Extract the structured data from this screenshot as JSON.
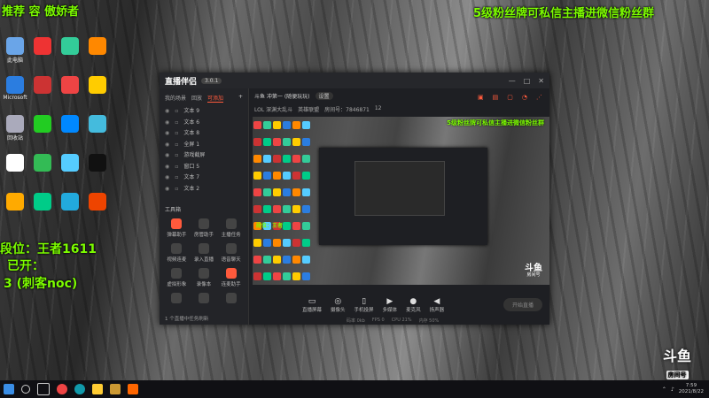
{
  "overlay": {
    "top_left": "推荐 容 傲娇者",
    "top_right": "5级粉丝牌可私信主播进微信粉丝群",
    "left_lines": [
      "段位：王者1611",
      "已开：",
      "3 (刺客noc)"
    ]
  },
  "desktop_icons": [
    {
      "label": "此电脑",
      "color": "#6aa5e8"
    },
    {
      "label": "",
      "color": "#e33"
    },
    {
      "label": "",
      "color": "#3c9"
    },
    {
      "label": "",
      "color": "#f80"
    },
    {
      "label": "Microsoft",
      "color": "#2b7de0"
    },
    {
      "label": "",
      "color": "#c33"
    },
    {
      "label": "",
      "color": "#e44"
    },
    {
      "label": "",
      "color": "#fc0"
    },
    {
      "label": "回收站",
      "color": "#aab"
    },
    {
      "label": "",
      "color": "#2c2"
    },
    {
      "label": "",
      "color": "#08f"
    },
    {
      "label": "",
      "color": "#4bd"
    },
    {
      "label": "",
      "color": "#fff"
    },
    {
      "label": "",
      "color": "#3b5"
    },
    {
      "label": "",
      "color": "#5cf"
    },
    {
      "label": "",
      "color": "#111"
    },
    {
      "label": "",
      "color": "#fa0"
    },
    {
      "label": "",
      "color": "#0c8"
    },
    {
      "label": "",
      "color": "#2ad"
    },
    {
      "label": "",
      "color": "#e40"
    }
  ],
  "window": {
    "title": "直播伴侣",
    "version": "3.0.1",
    "tabs": [
      "我的场景",
      "回放",
      "可添加"
    ],
    "sources": [
      "文本 9",
      "文本 6",
      "文本 8",
      "全屏 1",
      "游戏截屏",
      "窗口 5",
      "文本 7",
      "文本 2"
    ],
    "tools_header": "工具箱",
    "tools": [
      "弹幕助手",
      "房管助手",
      "主播任务",
      "视频连麦",
      "录入直播",
      "语音聊天",
      "虚拟形象",
      "录像本",
      "连麦助手",
      "",
      "",
      ""
    ],
    "footer": "1 个直播中任务刷新",
    "room_title": "斗鱼 冲第一 (随便玩玩)",
    "room_badge": "设置",
    "room_sub": [
      "LOL 深渊大乱斗",
      "英雄联盟",
      "房间号：7846871",
      "12"
    ],
    "preview_green_top": "5级粉丝牌可私信主播进微信粉丝群",
    "preview_green_left": "段位：王者",
    "controls": [
      "直播屏幕",
      "摄像头",
      "手机投屏",
      "多媒体",
      "麦克风",
      "扬声器"
    ],
    "go_button": "开始直播",
    "status": [
      "码率 0kb",
      "FPS 0",
      "CPU 21%",
      "内存 50%"
    ]
  },
  "brand": {
    "logo": "斗鱼",
    "room_label": "房间号",
    "room_id": "7846871"
  },
  "taskbar": {
    "time": "7:59",
    "date": "2021/8/22"
  }
}
